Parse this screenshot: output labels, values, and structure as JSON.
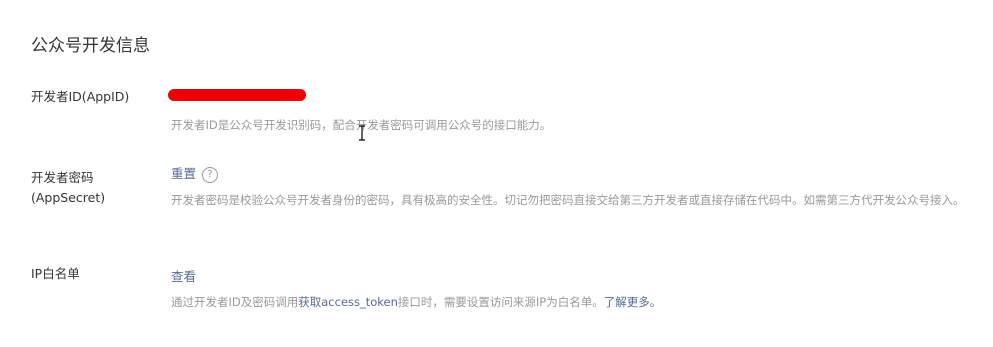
{
  "section": {
    "title": "公众号开发信息"
  },
  "appid": {
    "label": "开发者ID(AppID)",
    "value_redacted": true,
    "description": "开发者ID是公众号开发识别码，配合开发者密码可调用公众号的接口能力。"
  },
  "appsecret": {
    "label_line1": "开发者密码",
    "label_line2": "(AppSecret)",
    "action_label": "重置",
    "help_icon": "question-circle-icon",
    "description": "开发者密码是校验公众号开发者身份的密码，具有极高的安全性。切记勿把密码直接交给第三方开发者或直接存储在代码中。如需第三方代开发公众号接入。"
  },
  "ip_whitelist": {
    "label": "IP白名单",
    "action_label": "查看",
    "description_prefix": "通过开发者ID及密码调用",
    "description_link": "获取access_token",
    "description_suffix": "接口时，需要设置访问来源IP为白名单。",
    "learn_more": "了解更多。"
  },
  "colors": {
    "link": "#576b95",
    "muted": "#9a9a9a",
    "text": "#353535",
    "redaction": "#ee0000"
  }
}
